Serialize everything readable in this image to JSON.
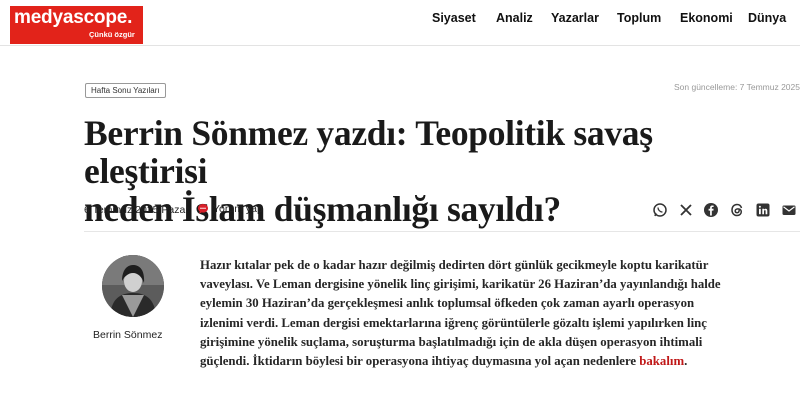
{
  "header": {
    "logo_text": "medyascope.",
    "logo_tagline": "Çünkü özgür",
    "nav": [
      "Siyaset",
      "Analiz",
      "Yazarlar",
      "Toplum",
      "Ekonomi",
      "Dünya"
    ]
  },
  "article": {
    "category_tag": "Hafta Sonu Yazıları",
    "updated": "Son güncelleme: 7 Temmuz 2025",
    "title_line1": "Berrin Sönmez yazdı: Teopolitik savaş eleştirisi",
    "title_line2": "neden İslam düşmanlığı sayıldı?",
    "date": "6 Temmuz 2025 Pazar",
    "comment_label": "Yorum yap",
    "share_icons": [
      "whatsapp-icon",
      "x-icon",
      "facebook-icon",
      "threads-icon",
      "linkedin-icon",
      "email-icon"
    ],
    "author_name": "Berrin Sönmez",
    "body_main": "Hazır kıtalar pek de o kadar hazır değilmiş dedirten dört günlük gecikmeyle koptu karikatür vaveylası. Ve Leman dergisine yönelik linç girişimi, karikatür 26 Haziran’da yayınlandığı halde eylemin 30 Haziran’da gerçekleşmesi anlık toplumsal öfkeden çok zaman ayarlı operasyon izlenimi verdi. Leman dergisi emektarlarına iğrenç görüntülerle gözaltı işlemi yapılırken linç girişimine yönelik suçlama, soruşturma başlatılmadığı için de akla düşen operasyon ihtimali güçlendi. İktidarın böylesi bir operasyona ihtiyaç duymasına yol açan nedenlere ",
    "body_link": "bakalım",
    "body_end": "."
  },
  "colors": {
    "brand": "#e2231a",
    "link": "#c01818"
  }
}
